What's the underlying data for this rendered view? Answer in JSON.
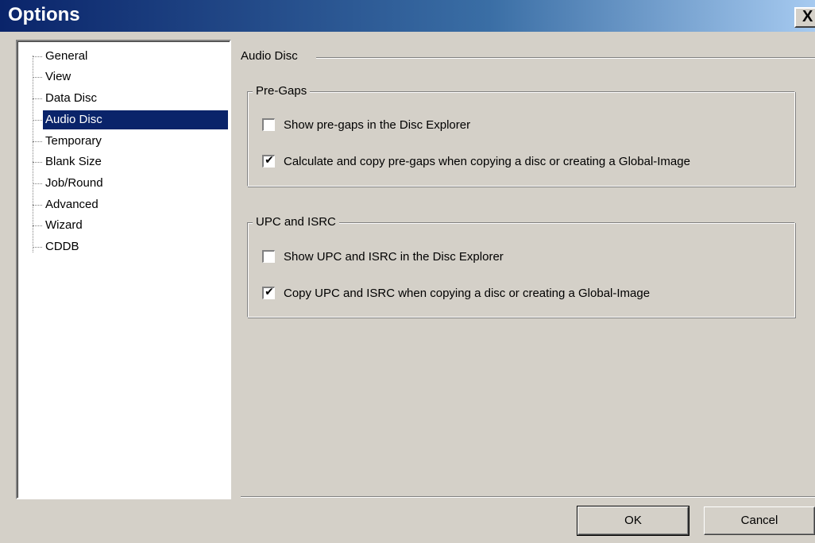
{
  "window": {
    "title": "Options",
    "close_label": "X"
  },
  "tree": {
    "items": [
      {
        "label": "General"
      },
      {
        "label": "View"
      },
      {
        "label": "Data Disc"
      },
      {
        "label": "Audio Disc",
        "selected": true
      },
      {
        "label": "Temporary"
      },
      {
        "label": "Blank Size"
      },
      {
        "label": "Job/Round"
      },
      {
        "label": "Advanced"
      },
      {
        "label": "Wizard"
      },
      {
        "label": "CDDB"
      }
    ]
  },
  "page": {
    "title": "Audio Disc",
    "pregaps": {
      "legend": "Pre-Gaps",
      "show": {
        "label": "Show pre-gaps in the Disc Explorer",
        "checked": false
      },
      "calculate": {
        "label": "Calculate and copy pre-gaps when copying a disc or creating a Global-Image",
        "checked": true
      }
    },
    "upc": {
      "legend": "UPC and ISRC",
      "show": {
        "label": "Show UPC and ISRC in the Disc Explorer",
        "checked": false
      },
      "copy": {
        "label": "Copy UPC and ISRC when copying a disc or creating a Global-Image",
        "checked": true
      }
    }
  },
  "buttons": {
    "ok": "OK",
    "cancel": "Cancel"
  }
}
